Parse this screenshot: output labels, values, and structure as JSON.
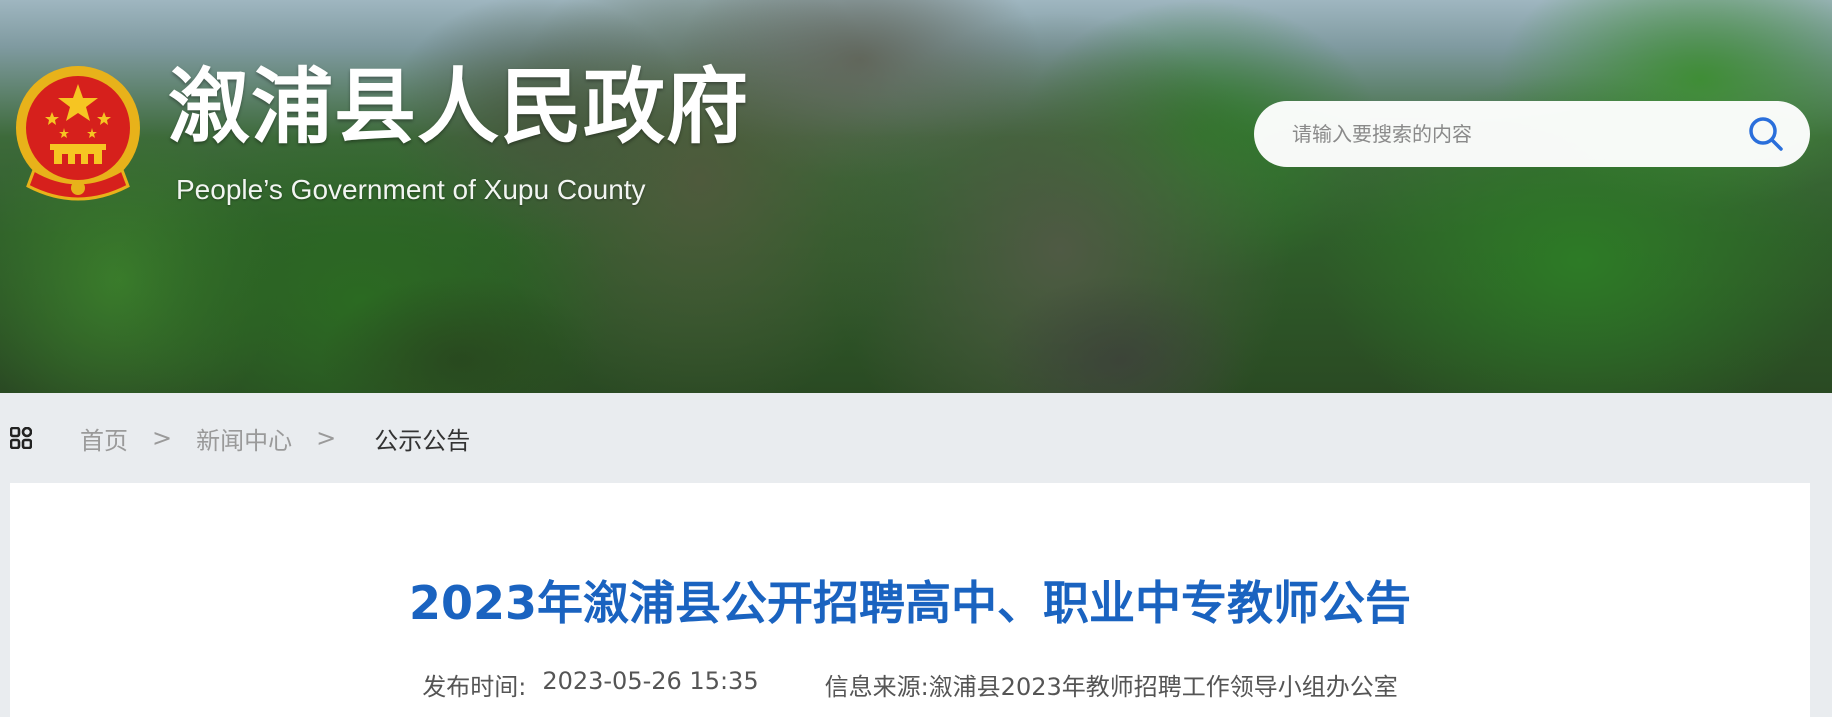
{
  "header": {
    "site_title": "溆浦县人民政府",
    "site_subtitle": "People’s Government of Xupu County",
    "emblem_icon": "national-emblem-icon"
  },
  "search": {
    "placeholder": "请输入要搜索的内容",
    "icon": "search-icon",
    "accent": "#2a6fdb"
  },
  "breadcrumb": {
    "icon": "grid-menu-icon",
    "home": "首页",
    "sep": ">",
    "news": "新闻中心",
    "current": "公示公告"
  },
  "article": {
    "title": "2023年溆浦县公开招聘高中、职业中专教师公告",
    "title_color": "#1a63c0",
    "publish_label": "发布时间:",
    "publish_time": "2023-05-26 15:35",
    "source_label": "信息来源:",
    "source": "溆浦县2023年教师招聘工作领导小组办公室"
  }
}
